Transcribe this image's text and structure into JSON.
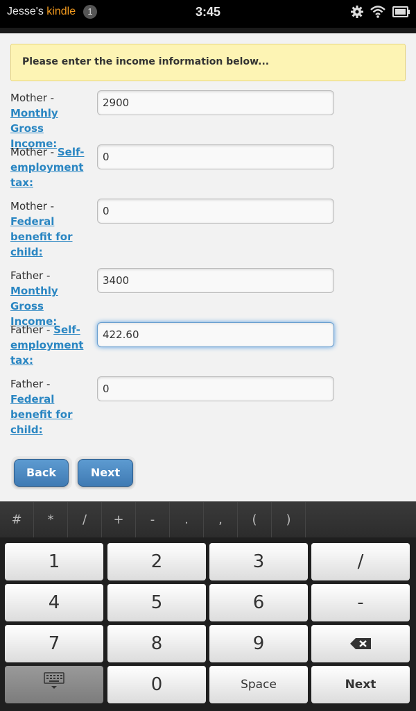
{
  "status_bar": {
    "owner_prefix": "Jesse's ",
    "owner_brand": "kindle",
    "notification_count": "1",
    "time": "3:45"
  },
  "notice": "Please enter the income information below...",
  "fields": [
    {
      "prefix": "Mother - ",
      "link": "Monthly Gross Income:",
      "value": "2900"
    },
    {
      "prefix": "Mother - ",
      "link": "Self-employment tax:",
      "value": "0"
    },
    {
      "prefix": "Mother - ",
      "link": "Federal benefit for child:",
      "value": "0"
    },
    {
      "prefix": "Father - ",
      "link": "Monthly Gross Income:",
      "value": "3400"
    },
    {
      "prefix": "Father - ",
      "link": "Self-employment tax:",
      "value": "422.60"
    },
    {
      "prefix": "Father - ",
      "link": "Federal benefit for child:",
      "value": "0"
    }
  ],
  "buttons": {
    "back": "Back",
    "next": "Next"
  },
  "keyboard": {
    "symbols": [
      "#",
      "*",
      "/",
      "+",
      "-",
      ".",
      ",",
      "(",
      ")"
    ],
    "keys": {
      "k1": "1",
      "k2": "2",
      "k3": "3",
      "slash": "/",
      "k4": "4",
      "k5": "5",
      "k6": "6",
      "minus": "-",
      "k7": "7",
      "k8": "8",
      "k9": "9",
      "k0": "0",
      "space": "Space",
      "next": "Next"
    }
  },
  "colors": {
    "link": "#2a86c2",
    "button": "#4a86c0",
    "notice_bg": "#fdf4b4"
  }
}
